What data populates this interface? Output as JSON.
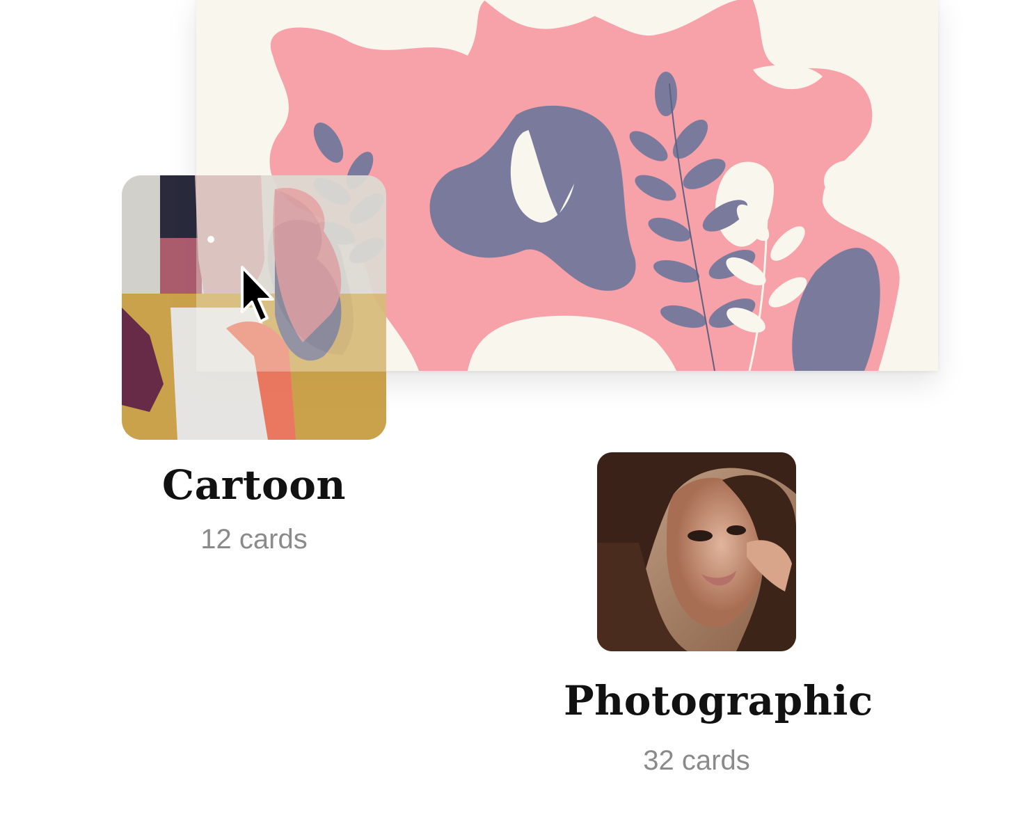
{
  "hero": {
    "image": "abstract-woman-with-leaves-illustration",
    "colors": {
      "background": "#f9f6ee",
      "blob": "#f7a1a8",
      "leaf": "#7a7b9c",
      "light_leaf": "#f9f6ee"
    }
  },
  "categories": [
    {
      "title": "Cartoon",
      "count_label": "12 cards",
      "thumbnail": "cartoon-illustration-thumbnail"
    },
    {
      "title": "Photographic",
      "count_label": "32 cards",
      "thumbnail": "portrait-photo-thumbnail"
    }
  ],
  "cursor": {
    "icon": "arrow-cursor-icon"
  }
}
